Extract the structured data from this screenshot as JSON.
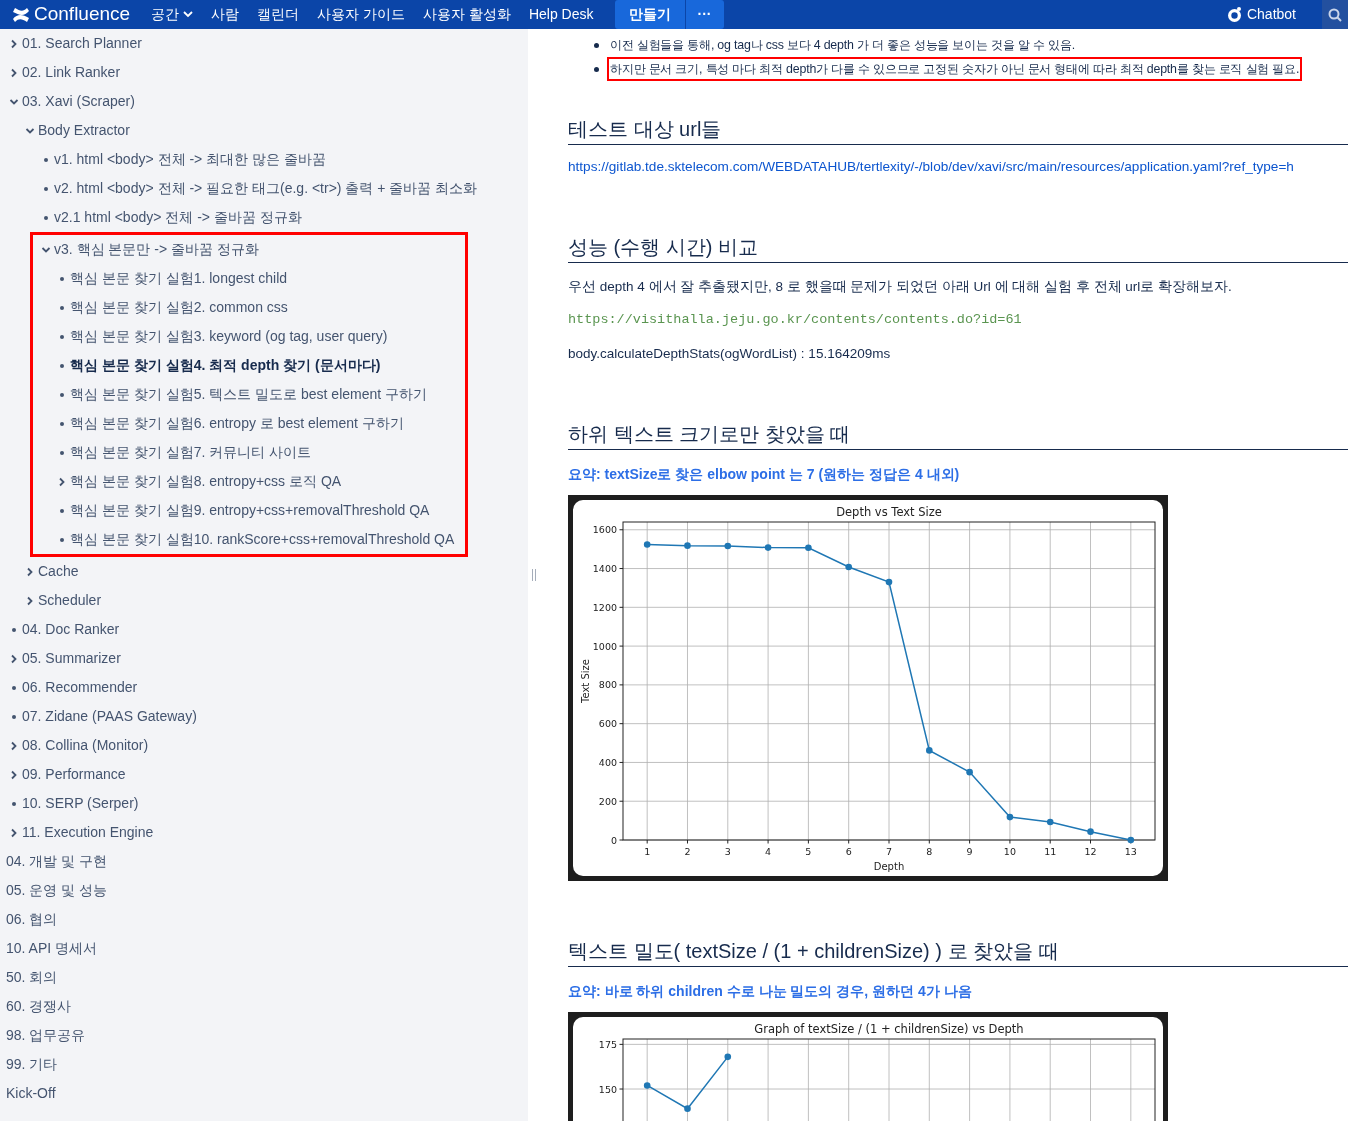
{
  "navbar": {
    "logo": "Confluence",
    "menu": [
      {
        "label": "공간",
        "dropdown": true
      },
      {
        "label": "사람",
        "dropdown": false
      },
      {
        "label": "캘린더",
        "dropdown": false
      },
      {
        "label": "사용자 가이드",
        "dropdown": false
      },
      {
        "label": "사용자 활성화",
        "dropdown": false
      },
      {
        "label": "Help Desk",
        "dropdown": false
      }
    ],
    "create_button": "만들기",
    "more_button": "···",
    "chatbot": "Chatbot"
  },
  "sidebar": {
    "tree": [
      {
        "label": "01. Search Planner",
        "selected": false,
        "expanded": false
      },
      {
        "label": "02. Link Ranker",
        "selected": false,
        "expanded": false
      },
      {
        "label": "03. Xavi (Scraper)",
        "selected": false,
        "expanded": true,
        "children": [
          {
            "label": "Body Extractor",
            "selected": false,
            "expanded": true,
            "children": [
              {
                "label": "v1. html <body> 전체 -> 최대한 많은 줄바꿈",
                "selected": false
              },
              {
                "label": "v2. html <body> 전체 -> 필요한 태그(e.g. <tr>) 출력 + 줄바꿈 최소화",
                "selected": false
              },
              {
                "label": "v2.1 html <body> 전체 -> 줄바꿈 정규화",
                "selected": false
              },
              {
                "label": "v3. 핵심 본문만 -> 줄바꿈 정규화",
                "selected": false,
                "expanded": true,
                "highlighted": true,
                "children": [
                  {
                    "label": "핵심 본문 찾기 실험1. longest child",
                    "selected": false
                  },
                  {
                    "label": "핵심 본문 찾기 실험2. common css",
                    "selected": false
                  },
                  {
                    "label": "핵심 본문 찾기 실험3. keyword (og tag, user query)",
                    "selected": false
                  },
                  {
                    "label": "핵심 본문 찾기 실험4. 최적 depth 찾기 (문서마다)",
                    "selected": true
                  },
                  {
                    "label": "핵심 본문 찾기 실험5. 텍스트 밀도로 best element 구하기",
                    "selected": false
                  },
                  {
                    "label": "핵심 본문 찾기 실험6. entropy 로 best element 구하기",
                    "selected": false
                  },
                  {
                    "label": "핵심 본문 찾기 실험7. 커뮤니티 사이트",
                    "selected": false
                  },
                  {
                    "label": "핵심 본문 찾기 실험8. entropy+css 로직 QA",
                    "selected": false,
                    "expanded": false
                  },
                  {
                    "label": "핵심 본문 찾기 실험9. entropy+css+removalThreshold QA",
                    "selected": false
                  },
                  {
                    "label": "핵심 본문 찾기 실험10. rankScore+css+removalThreshold QA",
                    "selected": false
                  }
                ]
              }
            ]
          },
          {
            "label": "Cache",
            "selected": false,
            "expanded": false
          },
          {
            "label": "Scheduler",
            "selected": false,
            "expanded": false
          }
        ]
      },
      {
        "label": "04. Doc Ranker",
        "selected": false
      },
      {
        "label": "05. Summarizer",
        "selected": false,
        "expanded": false
      },
      {
        "label": "06. Recommender",
        "selected": false
      },
      {
        "label": "07. Zidane (PAAS Gateway)",
        "selected": false
      },
      {
        "label": "08. Collina (Monitor)",
        "selected": false,
        "expanded": false
      },
      {
        "label": "09. Performance",
        "selected": false,
        "expanded": false
      },
      {
        "label": "10. SERP (Serper)",
        "selected": false
      },
      {
        "label": "11. Execution Engine",
        "selected": false,
        "expanded": false
      }
    ],
    "pages": [
      {
        "label": "04. 개발 및 구현",
        "selected": false
      },
      {
        "label": "05. 운영 및 성능",
        "selected": false
      },
      {
        "label": "06. 협의",
        "selected": false
      },
      {
        "label": "10. API 명세서",
        "selected": false
      },
      {
        "label": "50. 회의",
        "selected": false
      },
      {
        "label": "60. 경쟁사",
        "selected": false
      },
      {
        "label": "98. 업무공유",
        "selected": false
      },
      {
        "label": "99. 기타",
        "selected": false
      },
      {
        "label": "Kick-Off",
        "selected": false
      }
    ]
  },
  "content": [
    {
      "kind": "bullets",
      "items": [
        {
          "text": "이전 실험들을 통해, og tag나 css 보다 4 depth 가 더 좋은 성능을 보이는 것을 알 수 있음.",
          "highlighted": false
        },
        {
          "text": "하지만 문서 크기, 특성 마다 최적 depth가 다를 수 있으므로 고정된 숫자가 아닌 문서 형태에 따라 최적 depth를 찾는 로직 실험 필요.",
          "highlighted": true
        }
      ]
    },
    {
      "kind": "heading",
      "text": "테스트 대상 url들"
    },
    {
      "kind": "link",
      "text": "https://gitlab.tde.sktelecom.com/WEBDATAHUB/tertlexity/-/blob/dev/xavi/src/main/resources/application.yaml?ref_type=h"
    },
    {
      "kind": "heading",
      "text": "성능 (수행 시간) 비교"
    },
    {
      "kind": "paragraph",
      "text": "우선 depth 4 에서 잘 추출됐지만, 8 로 했을때 문제가 되었던 아래 Url 에 대해 실험 후 전체 url로 확장해보자."
    },
    {
      "kind": "code",
      "text": "https://visithalla.jeju.go.kr/contents/contents.do?id=61"
    },
    {
      "kind": "paragraph",
      "text": "body.calculateDepthStats(ogWordList) : 15.164209ms"
    },
    {
      "kind": "heading",
      "text": "하위 텍스트 크기로만 찾았을 때"
    },
    {
      "kind": "summary",
      "text": "요약: textSize로 찾은 elbow point 는 7 (원하는 정답은 4 내외)"
    },
    {
      "kind": "chart",
      "chart_data": {
        "type": "line",
        "title": "Depth vs Text Size",
        "xlabel": "Depth",
        "ylabel": "Text Size",
        "x": [
          1,
          2,
          3,
          4,
          5,
          6,
          7,
          8,
          9,
          10,
          11,
          12,
          13
        ],
        "series": [
          {
            "color": "#1f77b4",
            "marker": "o",
            "values": [
              1524,
              1518,
              1516,
              1508,
              1507,
              1408,
              1330,
              462,
              350,
              118,
              93,
              43,
              0
            ]
          }
        ],
        "xlim": [
          0.4,
          13.6
        ],
        "ylim": [
          0,
          1640
        ],
        "xticks": [
          1,
          2,
          3,
          4,
          5,
          6,
          7,
          8,
          9,
          10,
          11,
          12,
          13
        ],
        "yticks": [
          0,
          200,
          400,
          600,
          800,
          1000,
          1200,
          1400,
          1600
        ],
        "grid": true
      }
    },
    {
      "kind": "heading",
      "text": "텍스트 밀도( textSize / (1 + childrenSize) ) 로 찾았을 때"
    },
    {
      "kind": "summary",
      "text": "요약: 바로 하위 children 수로 나눈 밀도의 경우, 원하던 4가 나옴"
    },
    {
      "kind": "chart",
      "chart_data": {
        "type": "line",
        "title": "Graph of textSize / (1 + childrenSize) vs Depth",
        "x": [
          1,
          2,
          3
        ],
        "series": [
          {
            "color": "#1f77b4",
            "marker": "o",
            "values": [
              152,
              139,
              168
            ]
          }
        ],
        "xlim": [
          0.4,
          13.6
        ],
        "ylim": [
          0,
          178
        ],
        "yticks": [
          150,
          175
        ],
        "grid": true
      }
    }
  ]
}
